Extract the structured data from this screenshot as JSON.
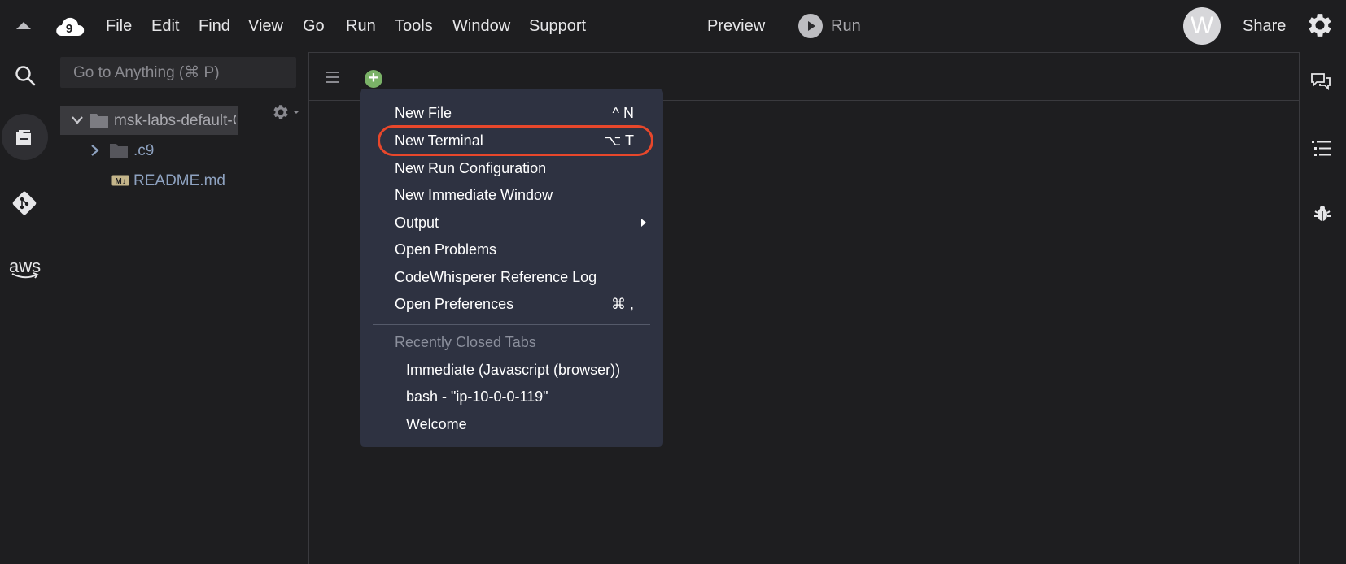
{
  "topbar": {
    "menus": [
      "File",
      "Edit",
      "Find",
      "View",
      "Go",
      "Run",
      "Tools",
      "Window",
      "Support"
    ],
    "preview_label": "Preview",
    "run_label": "Run",
    "avatar_letter": "W",
    "share_label": "Share"
  },
  "sidebar_rail": {
    "icons": [
      "search-icon",
      "files-icon",
      "git-icon",
      "aws-icon"
    ],
    "aws_label": "aws"
  },
  "file_panel": {
    "search_placeholder": "Go to Anything (⌘ P)",
    "tree": {
      "root_label": "msk-labs-default-C",
      "items": [
        {
          "label": ".c9",
          "type": "folder"
        },
        {
          "label": "README.md",
          "type": "markdown-file"
        }
      ]
    }
  },
  "editor": {
    "add_tab_label": "+"
  },
  "context_menu": {
    "items": [
      {
        "label": "New File",
        "shortcut": "^ N"
      },
      {
        "label": "New Terminal",
        "shortcut": "⌥ T",
        "highlighted": true
      },
      {
        "label": "New Run Configuration",
        "shortcut": ""
      },
      {
        "label": "New Immediate Window",
        "shortcut": ""
      },
      {
        "label": "Output",
        "shortcut": "",
        "submenu": true
      },
      {
        "label": "Open Problems",
        "shortcut": ""
      },
      {
        "label": "CodeWhisperer Reference Log",
        "shortcut": ""
      },
      {
        "label": "Open Preferences",
        "shortcut": "⌘ ,"
      }
    ],
    "section_label": "Recently Closed Tabs",
    "recent_tabs": [
      "Immediate (Javascript (browser))",
      "bash - \"ip-10-0-0-119\"",
      "Welcome"
    ]
  },
  "colors": {
    "background": "#1e1e20",
    "menu_bg": "#2e3241",
    "highlight": "#e8472b",
    "add_button": "#7ab267"
  }
}
